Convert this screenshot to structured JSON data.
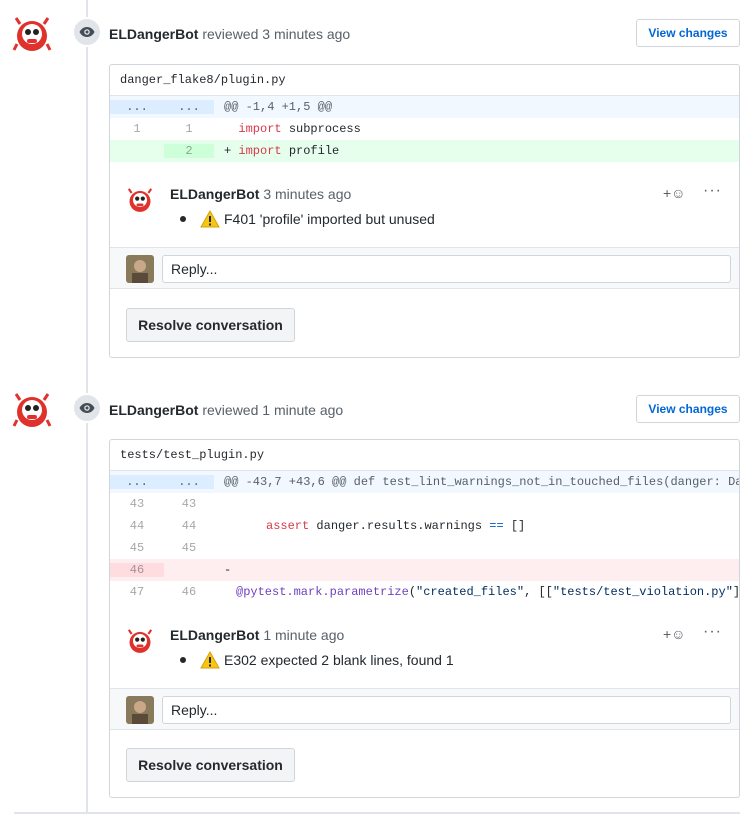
{
  "reviews": [
    {
      "author": "ELDangerBot",
      "action": "reviewed",
      "time": "3 minutes ago",
      "view_changes": "View changes",
      "file_path": "danger_flake8/plugin.py",
      "hunk_left": "...",
      "hunk_right": "...",
      "hunk_header": "@@ -1,4 +1,5 @@",
      "lines": [
        {
          "type": "context",
          "left": "1",
          "right": "1",
          "marker": "",
          "keyword": "import",
          "rest": " subprocess"
        },
        {
          "type": "add",
          "left": "",
          "right": "2",
          "marker": "+",
          "keyword": "import",
          "rest": " profile"
        }
      ],
      "comment": {
        "author": "ELDangerBot",
        "time": "3 minutes ago",
        "text": "F401 'profile' imported but unused",
        "reaction": "+☺",
        "more": "···"
      },
      "reply_placeholder": "Reply...",
      "resolve_label": "Resolve conversation"
    },
    {
      "author": "ELDangerBot",
      "action": "reviewed",
      "time": "1 minute ago",
      "view_changes": "View changes",
      "file_path": "tests/test_plugin.py",
      "hunk_left": "...",
      "hunk_right": "...",
      "hunk_header": "@@ -43,7 +43,6 @@ def test_lint_warnings_not_in_touched_files(danger: Da",
      "lines": [
        {
          "type": "context",
          "left": "43",
          "right": "43"
        },
        {
          "type": "context",
          "left": "44",
          "right": "44",
          "indent": "    ",
          "keyword": "assert",
          "rest": " danger.results.warnings ",
          "op": "==",
          "tail": " []"
        },
        {
          "type": "context",
          "left": "45",
          "right": "45"
        },
        {
          "type": "del",
          "left": "46",
          "right": "",
          "marker": "-"
        },
        {
          "type": "context",
          "left": "47",
          "right": "46",
          "deco": "@pytest.mark.parametrize",
          "paren": "(",
          "s1": "\"created_files\"",
          "mid": ", [[",
          "s2": "\"tests/test_violation.py\"",
          "end": "]"
        }
      ],
      "comment": {
        "author": "ELDangerBot",
        "time": "1 minute ago",
        "text": "E302 expected 2 blank lines, found 1",
        "reaction": "+☺",
        "more": "···"
      },
      "reply_placeholder": "Reply...",
      "resolve_label": "Resolve conversation"
    }
  ],
  "colors": {
    "link": "#0366d6",
    "add_bg": "#e6ffed",
    "del_bg": "#ffeef0",
    "hunk_bg": "#f1f8ff",
    "keyword": "#d73a49",
    "warning": "#f9c513"
  },
  "icons": {
    "timeline_badge": "eye-icon",
    "warning": "warning-icon",
    "reaction": "smiley-icon",
    "more": "kebab-horizontal-icon"
  }
}
